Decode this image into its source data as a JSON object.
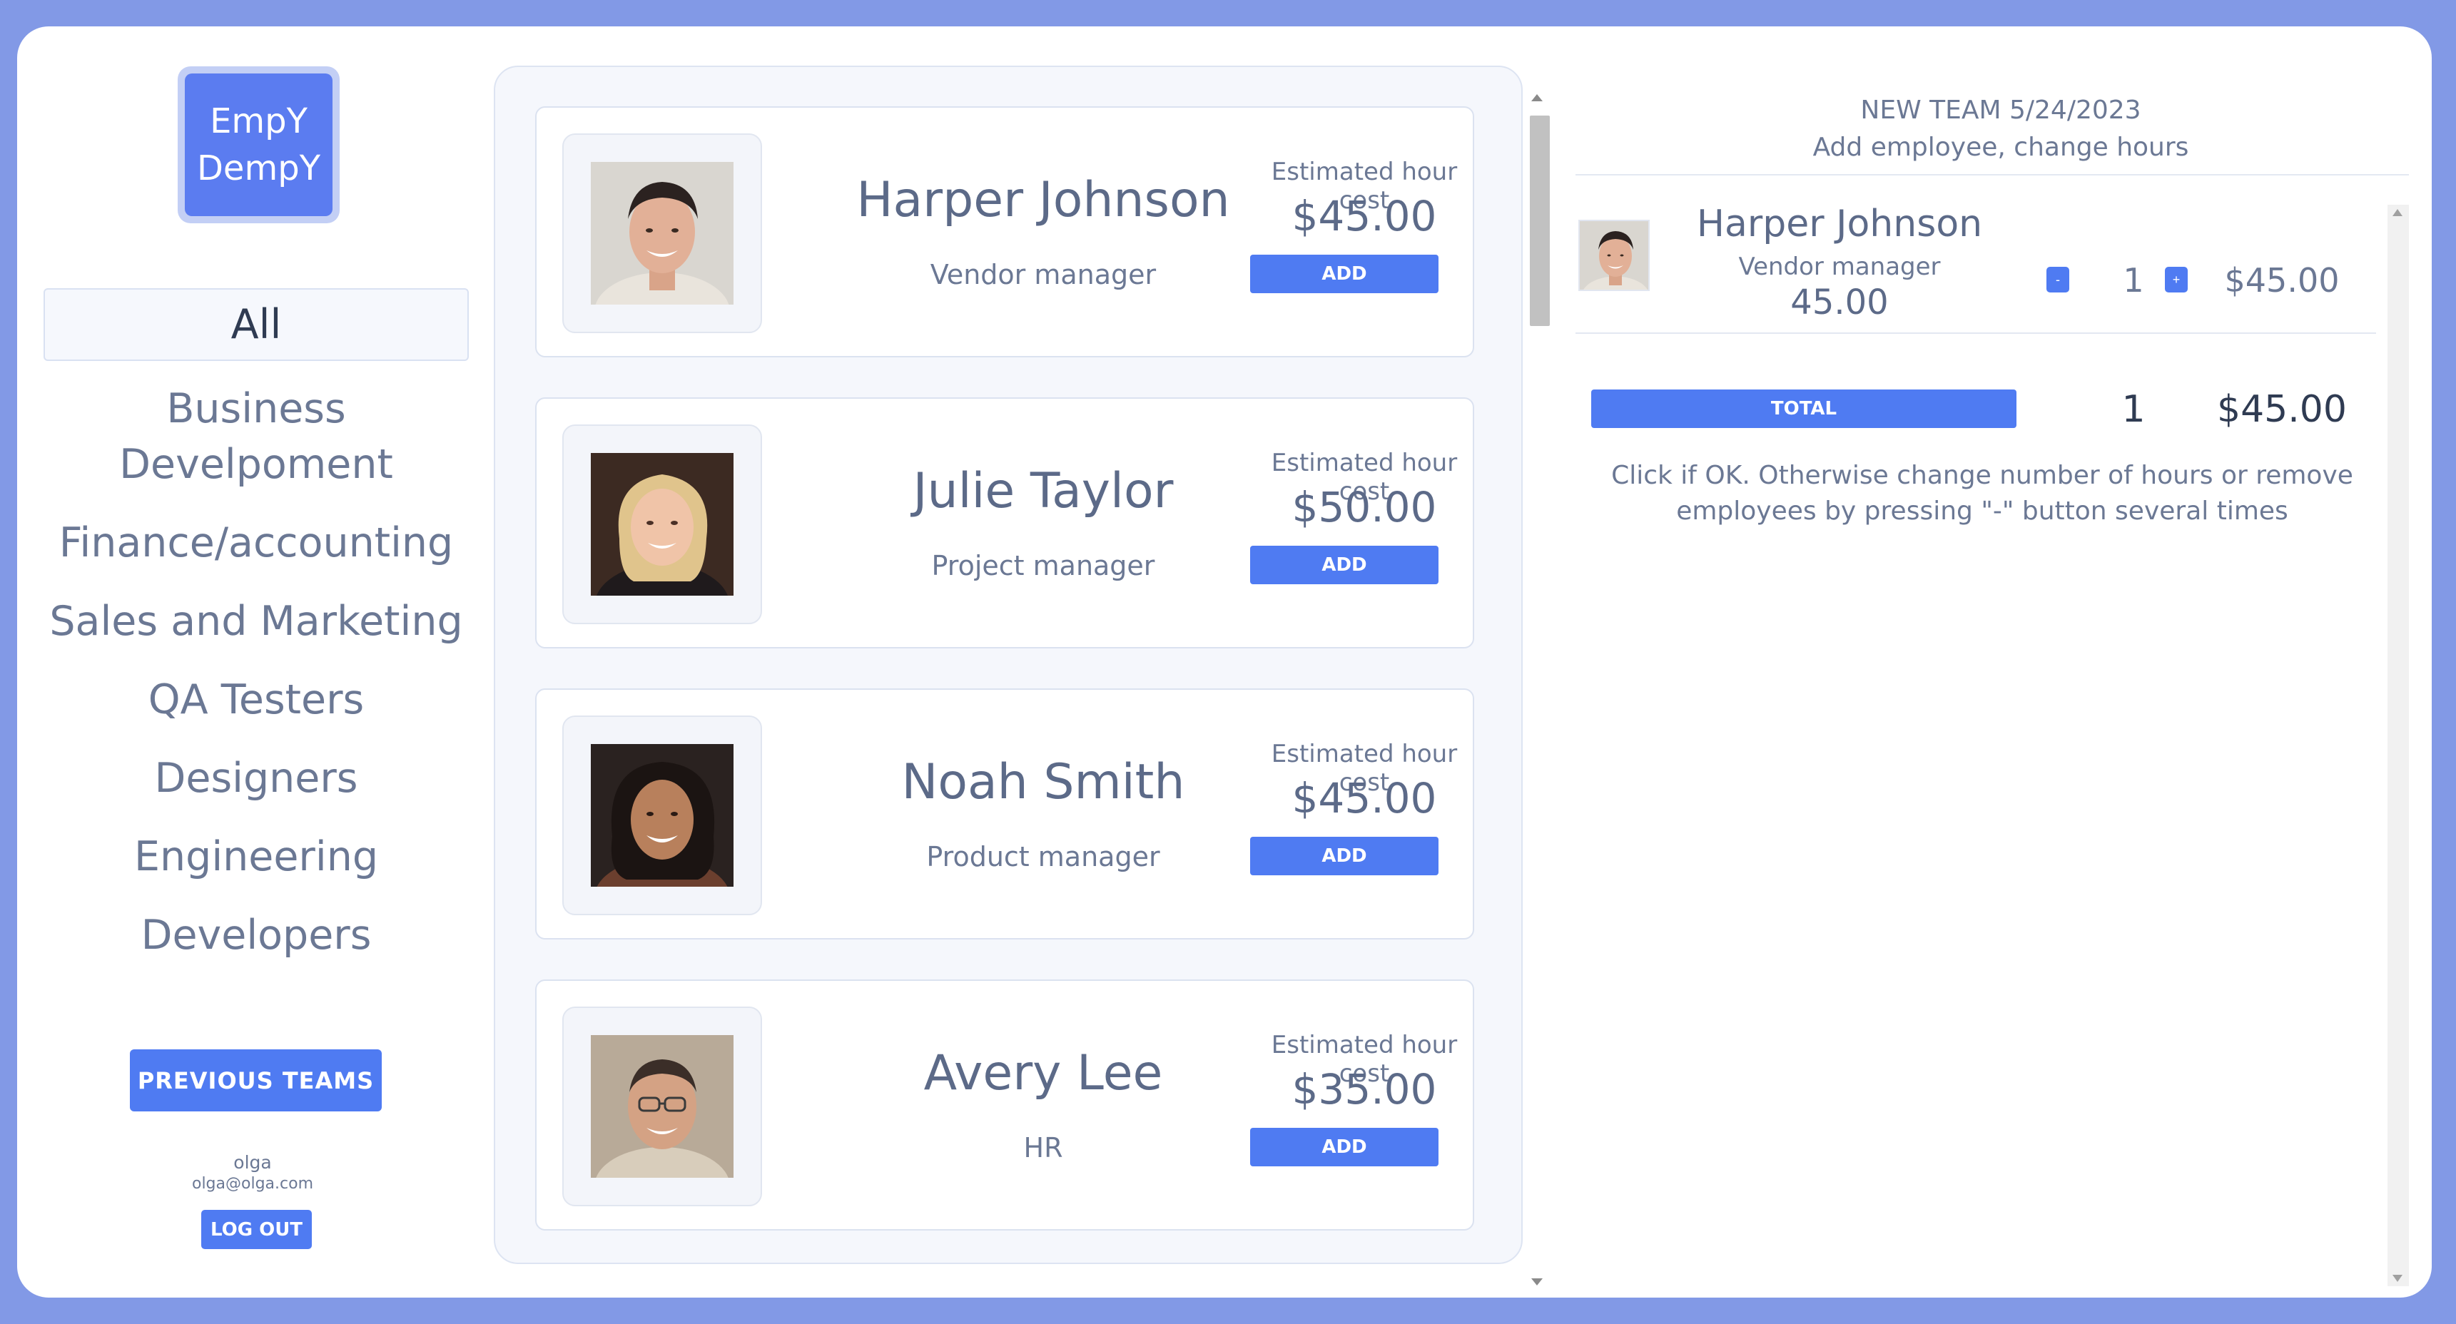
{
  "logo": {
    "line1": "EmpY",
    "line2": "DempY"
  },
  "sidebar": {
    "items": [
      {
        "label": "All",
        "active": true
      },
      {
        "label": "Business Develpoment",
        "line1": "Business",
        "line2": "Develpoment"
      },
      {
        "label": "Finance/accounting"
      },
      {
        "label": "Sales and Marketing"
      },
      {
        "label": "QA Testers"
      },
      {
        "label": "Designers"
      },
      {
        "label": "Engineering"
      },
      {
        "label": "Developers"
      }
    ],
    "previous_teams_label": "PREVIOUS TEAMS",
    "user": {
      "name": "olga",
      "email": "olga@olga.com"
    },
    "logout_label": "LOG OUT"
  },
  "employees": [
    {
      "name": "Harper Johnson",
      "role": "Vendor manager",
      "cost_label": "Estimated hour cost",
      "cost": "$45.00",
      "add_label": "ADD",
      "avatar": "man-young"
    },
    {
      "name": "Julie Taylor",
      "role": "Project manager",
      "cost_label": "Estimated hour cost",
      "cost": "$50.00",
      "add_label": "ADD",
      "avatar": "woman-blonde"
    },
    {
      "name": "Noah Smith",
      "role": "Product manager",
      "cost_label": "Estimated hour cost",
      "cost": "$45.00",
      "add_label": "ADD",
      "avatar": "woman-dark-curly"
    },
    {
      "name": "Avery Lee",
      "role": "HR",
      "cost_label": "Estimated hour cost",
      "cost": "$35.00",
      "add_label": "ADD",
      "avatar": "man-glasses"
    }
  ],
  "team": {
    "title": "NEW TEAM 5/24/2023",
    "subtitle": "Add employee, change hours",
    "members": [
      {
        "name": "Harper Johnson",
        "role": "Vendor manager",
        "rate": "45.00",
        "hours": "1",
        "amount": "$45.00",
        "minus": "-",
        "plus": "+"
      }
    ],
    "total_label": "TOTAL",
    "total_hours": "1",
    "total_amount": "$45.00",
    "hint": "Click if OK. Otherwise change number of hours or remove employees by pressing \"-\" button several times"
  },
  "colors": {
    "frame": "#8299e6",
    "accent": "#4f7bf2",
    "logo": "#5b7cf0",
    "text": "#6b7894",
    "text_dark": "#2f3b52"
  }
}
